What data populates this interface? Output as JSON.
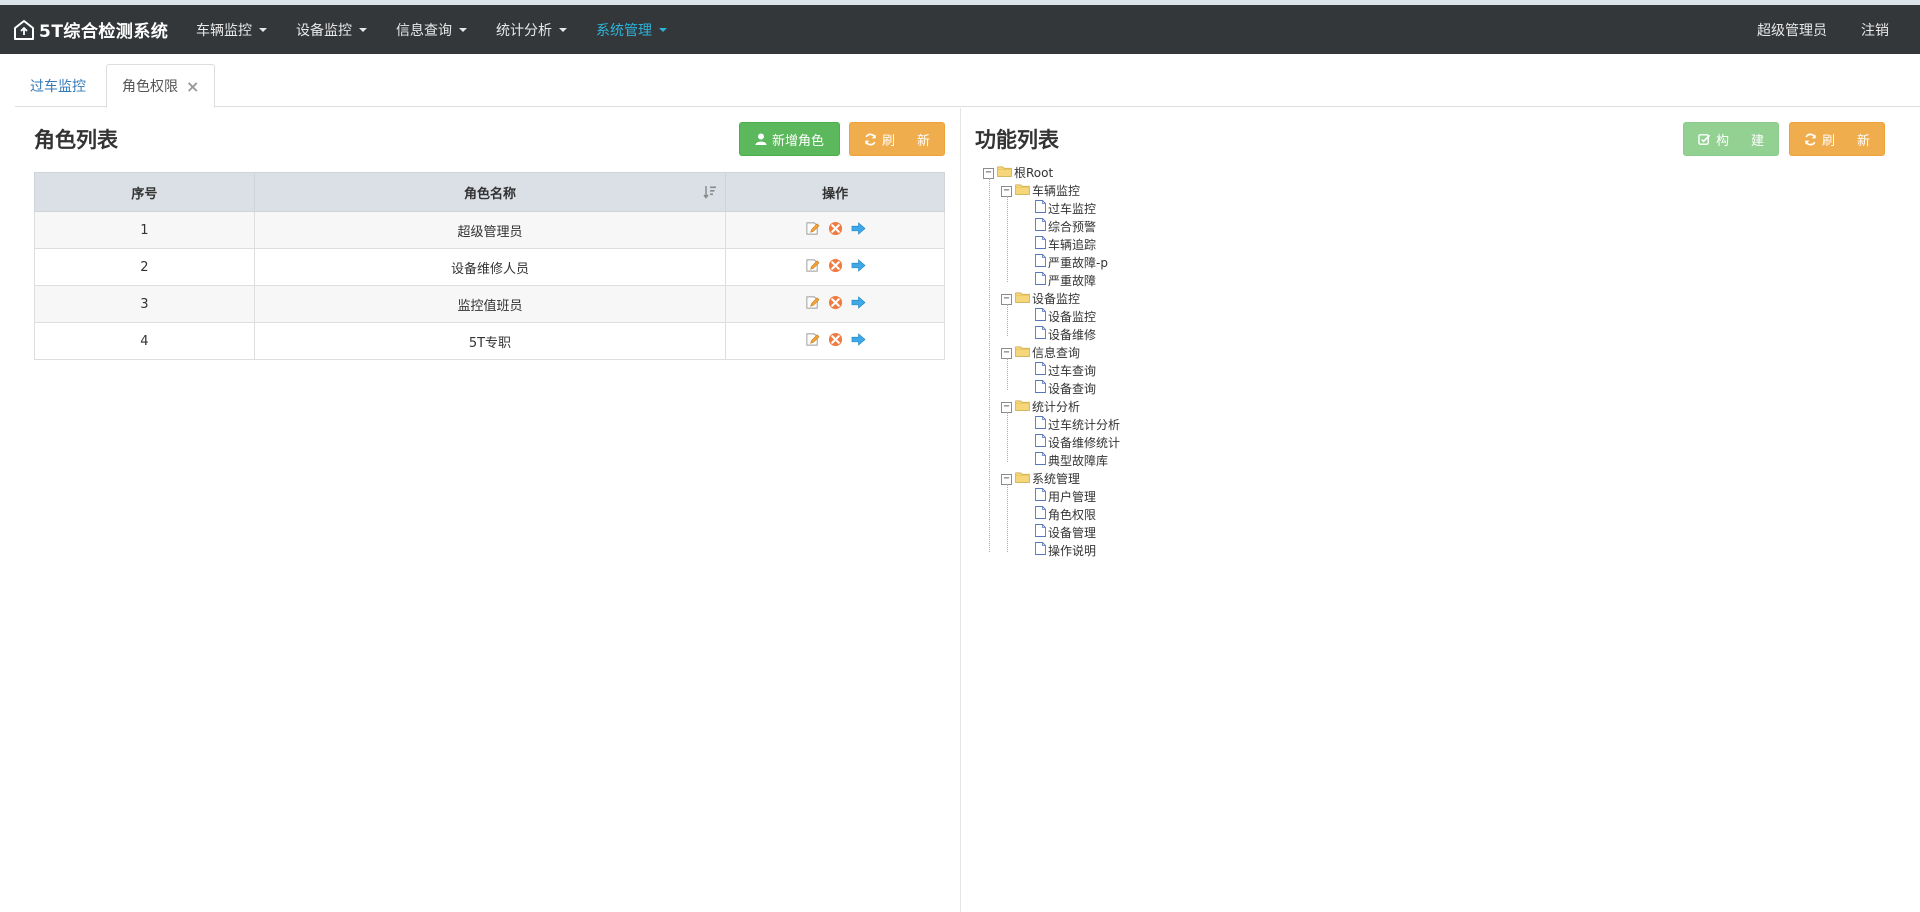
{
  "app": {
    "title": "5T综合检测系统",
    "menu": [
      {
        "label": "车辆监控",
        "active": false
      },
      {
        "label": "设备监控",
        "active": false
      },
      {
        "label": "信息查询",
        "active": false
      },
      {
        "label": "统计分析",
        "active": false
      },
      {
        "label": "系统管理",
        "active": true
      }
    ],
    "user": "超级管理员",
    "logout": "注销",
    "active_color": "#2fb2d8"
  },
  "tabs": [
    {
      "label": "过车监控",
      "active": false
    },
    {
      "label": "角色权限",
      "active": true,
      "closable": true
    }
  ],
  "tab_close_symbol": "×",
  "roles_panel": {
    "title": "角色列表",
    "add_button": "新增角色",
    "refresh_button": "刷新",
    "columns": [
      "序号",
      "角色名称",
      "操作"
    ],
    "rows": [
      {
        "index": "1",
        "name": "超级管理员"
      },
      {
        "index": "2",
        "name": "设备维修人员"
      },
      {
        "index": "3",
        "name": "监控值班员"
      },
      {
        "index": "4",
        "name": "5T专职"
      }
    ],
    "row_actions": [
      "edit-icon",
      "delete-icon",
      "assign-icon"
    ]
  },
  "functions_panel": {
    "title": "功能列表",
    "build_button": "构建",
    "refresh_button": "刷新",
    "tree": {
      "root": "根Root",
      "groups": [
        {
          "label": "车辆监控",
          "children": [
            "过车监控",
            "综合预警",
            "车辆追踪",
            "严重故障-p",
            "严重故障"
          ]
        },
        {
          "label": "设备监控",
          "children": [
            "设备监控",
            "设备维修"
          ]
        },
        {
          "label": "信息查询",
          "children": [
            "过车查询",
            "设备查询"
          ]
        },
        {
          "label": "统计分析",
          "children": [
            "过车统计分析",
            "设备维修统计",
            "典型故障库"
          ]
        },
        {
          "label": "系统管理",
          "children": [
            "用户管理",
            "角色权限",
            "设备管理",
            "操作说明"
          ]
        }
      ]
    }
  },
  "colors": {
    "navbar": "#33373a",
    "green": "#5cb85c",
    "orange": "#f0ad4e",
    "table_header": "#dbe0e6"
  }
}
